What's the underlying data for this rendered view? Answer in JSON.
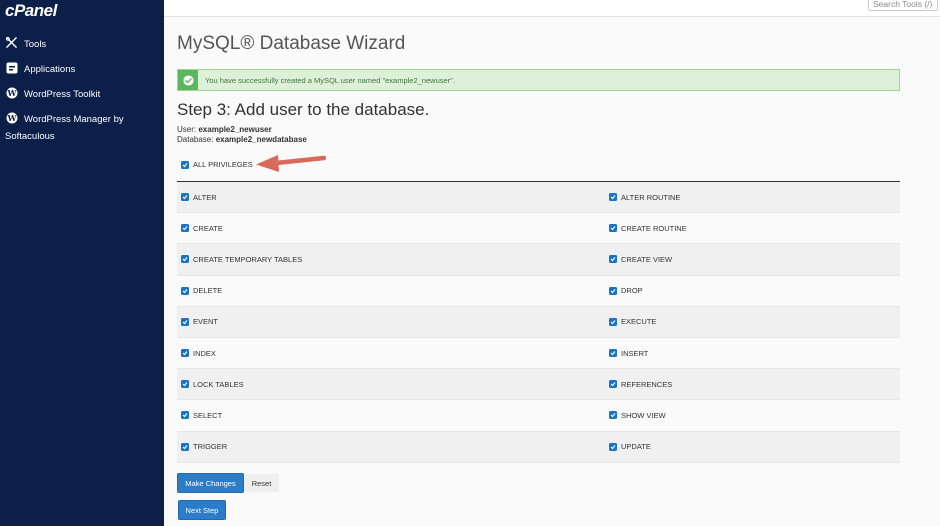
{
  "brand": {
    "logo": "cPanel"
  },
  "sidebar": {
    "items": [
      {
        "label": "Tools",
        "icon": "tools-icon"
      },
      {
        "label": "Applications",
        "icon": "applications-icon"
      },
      {
        "label": "WordPress Toolkit",
        "icon": "wordpress-icon"
      },
      {
        "label": "WordPress Manager by",
        "label2": "Softaculous",
        "icon": "wordpress-icon"
      }
    ]
  },
  "topbar": {
    "search_placeholder": "Search Tools (/)"
  },
  "main": {
    "title": "MySQL® Database Wizard",
    "alert": {
      "message": "You have successfully created a MySQL user named \"example2_newuser\".",
      "color": "#5cb85c"
    },
    "step_title": "Step 3: Add user to the database.",
    "user_label": "User:",
    "user_value": "example2_newuser",
    "database_label": "Database:",
    "database_value": "example2_newdatabase",
    "all_privileges": {
      "label": "ALL PRIVILEGES",
      "checked": true
    },
    "privileges": [
      {
        "left": "ALTER",
        "right": "ALTER ROUTINE"
      },
      {
        "left": "CREATE",
        "right": "CREATE ROUTINE"
      },
      {
        "left": "CREATE TEMPORARY TABLES",
        "right": "CREATE VIEW"
      },
      {
        "left": "DELETE",
        "right": "DROP"
      },
      {
        "left": "EVENT",
        "right": "EXECUTE"
      },
      {
        "left": "INDEX",
        "right": "INSERT"
      },
      {
        "left": "LOCK TABLES",
        "right": "REFERENCES"
      },
      {
        "left": "SELECT",
        "right": "SHOW VIEW"
      },
      {
        "left": "TRIGGER",
        "right": "UPDATE"
      }
    ],
    "buttons": {
      "make_changes": "Make Changes",
      "reset": "Reset",
      "next_step": "Next Step"
    }
  },
  "colors": {
    "sidebar_bg": "#0b1f49",
    "accent": "#2b7cc9",
    "checkbox": "#1a73c9",
    "arrow": "#d9695a"
  }
}
